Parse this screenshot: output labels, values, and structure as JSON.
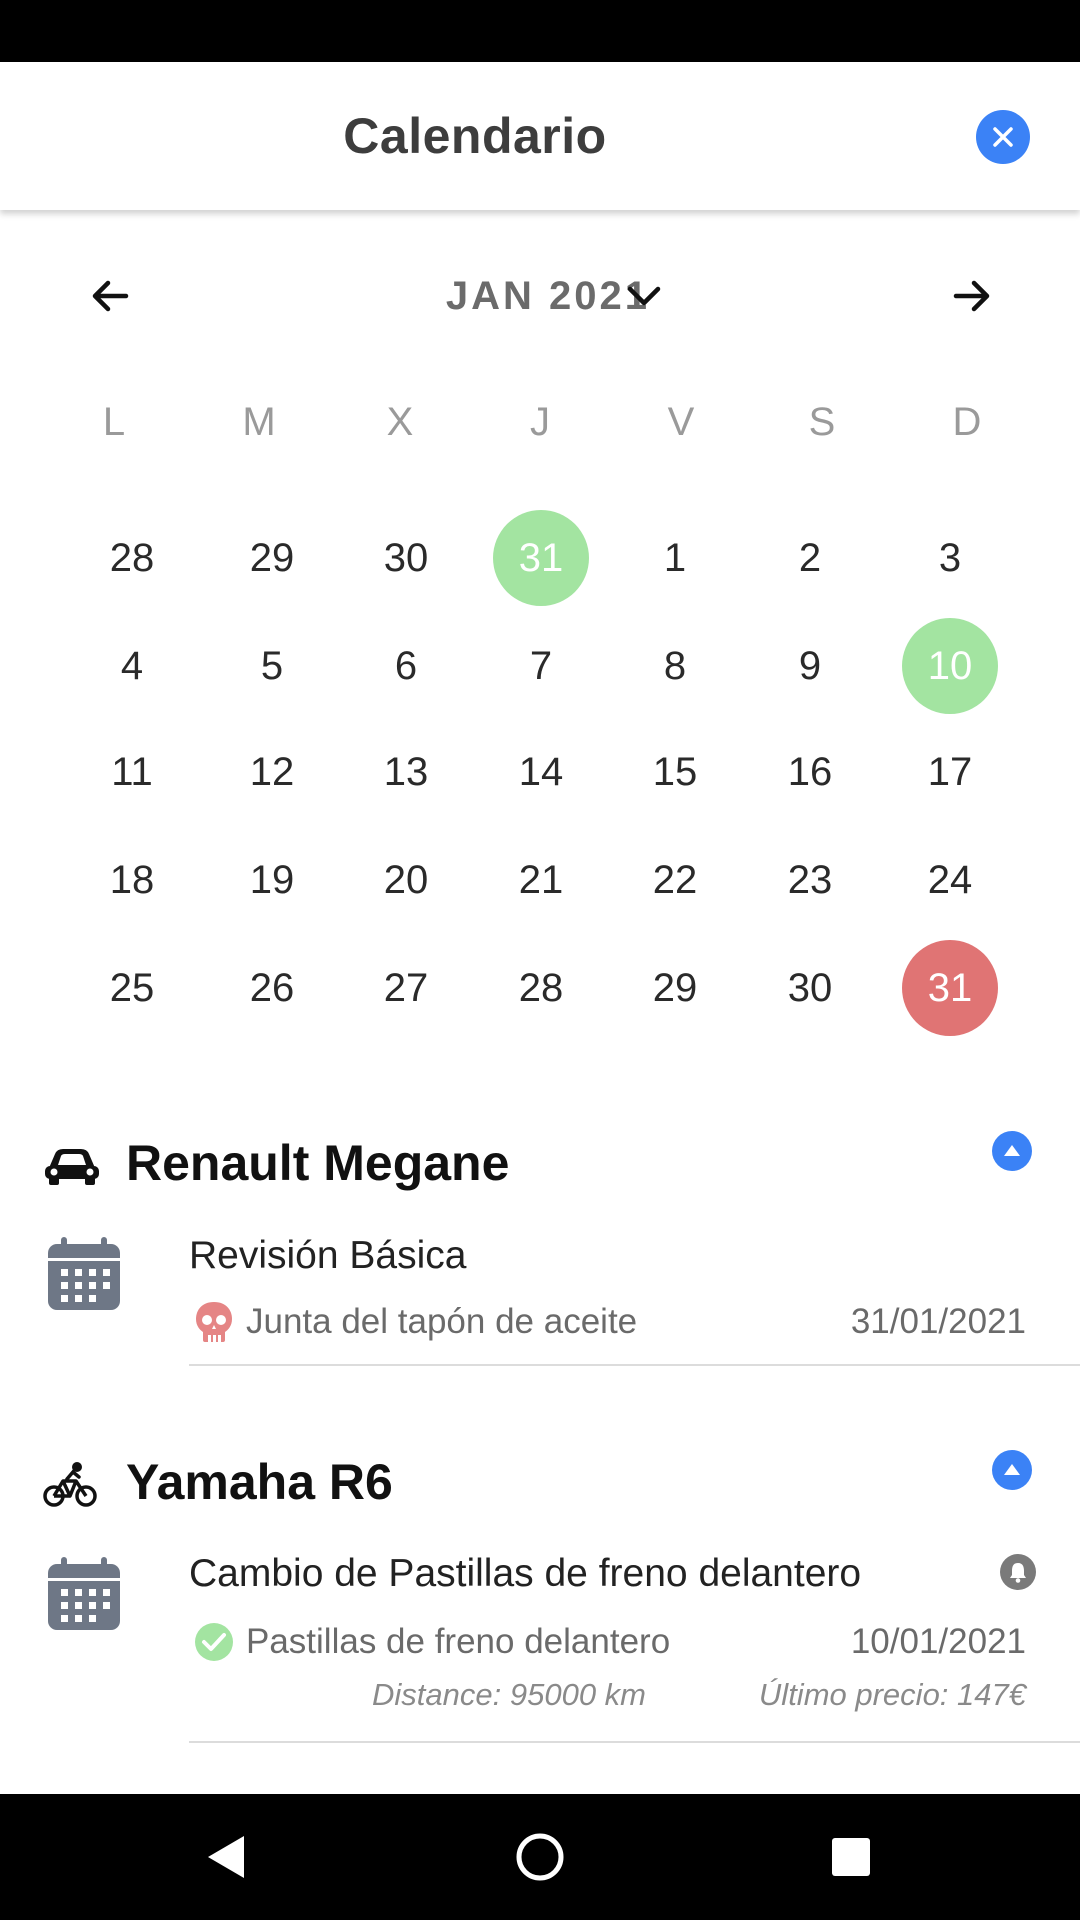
{
  "header": {
    "title": "Calendario",
    "close_icon": "close-icon"
  },
  "month_nav": {
    "label": "JAN 2021",
    "prev_icon": "arrow-left-icon",
    "next_icon": "arrow-right-icon",
    "dropdown_icon": "chevron-down-icon"
  },
  "weekdays": [
    "L",
    "M",
    "X",
    "J",
    "V",
    "S",
    "D"
  ],
  "weeks": [
    [
      "28",
      "29",
      "30",
      "31",
      "1",
      "2",
      "3"
    ],
    [
      "4",
      "5",
      "6",
      "7",
      "8",
      "9",
      "10"
    ],
    [
      "11",
      "12",
      "13",
      "14",
      "15",
      "16",
      "17"
    ],
    [
      "18",
      "19",
      "20",
      "21",
      "22",
      "23",
      "24"
    ],
    [
      "25",
      "26",
      "27",
      "28",
      "29",
      "30",
      "31"
    ]
  ],
  "highlights": [
    {
      "week": 0,
      "day": 3,
      "status": "green"
    },
    {
      "week": 1,
      "day": 6,
      "status": "green"
    },
    {
      "week": 4,
      "day": 6,
      "status": "red"
    }
  ],
  "colors": {
    "accent": "#3b82f6",
    "done": "#a3e4a1",
    "overdue": "#e07474"
  },
  "vehicles": [
    {
      "name": "Renault Megane",
      "icon": "car-icon",
      "task": {
        "title": "Revisión Básica",
        "part": "Junta del tapón de aceite",
        "part_icon": "skull-icon",
        "date": "31/01/2021"
      }
    },
    {
      "name": "Yamaha R6",
      "icon": "bicycle-icon",
      "task": {
        "title": "Cambio de Pastillas de freno delantero",
        "part": "Pastillas de freno delantero",
        "part_icon": "check-circle-icon",
        "date": "10/01/2021",
        "distance": "Distance: 95000 km",
        "price": "Último precio: 147€"
      }
    }
  ]
}
